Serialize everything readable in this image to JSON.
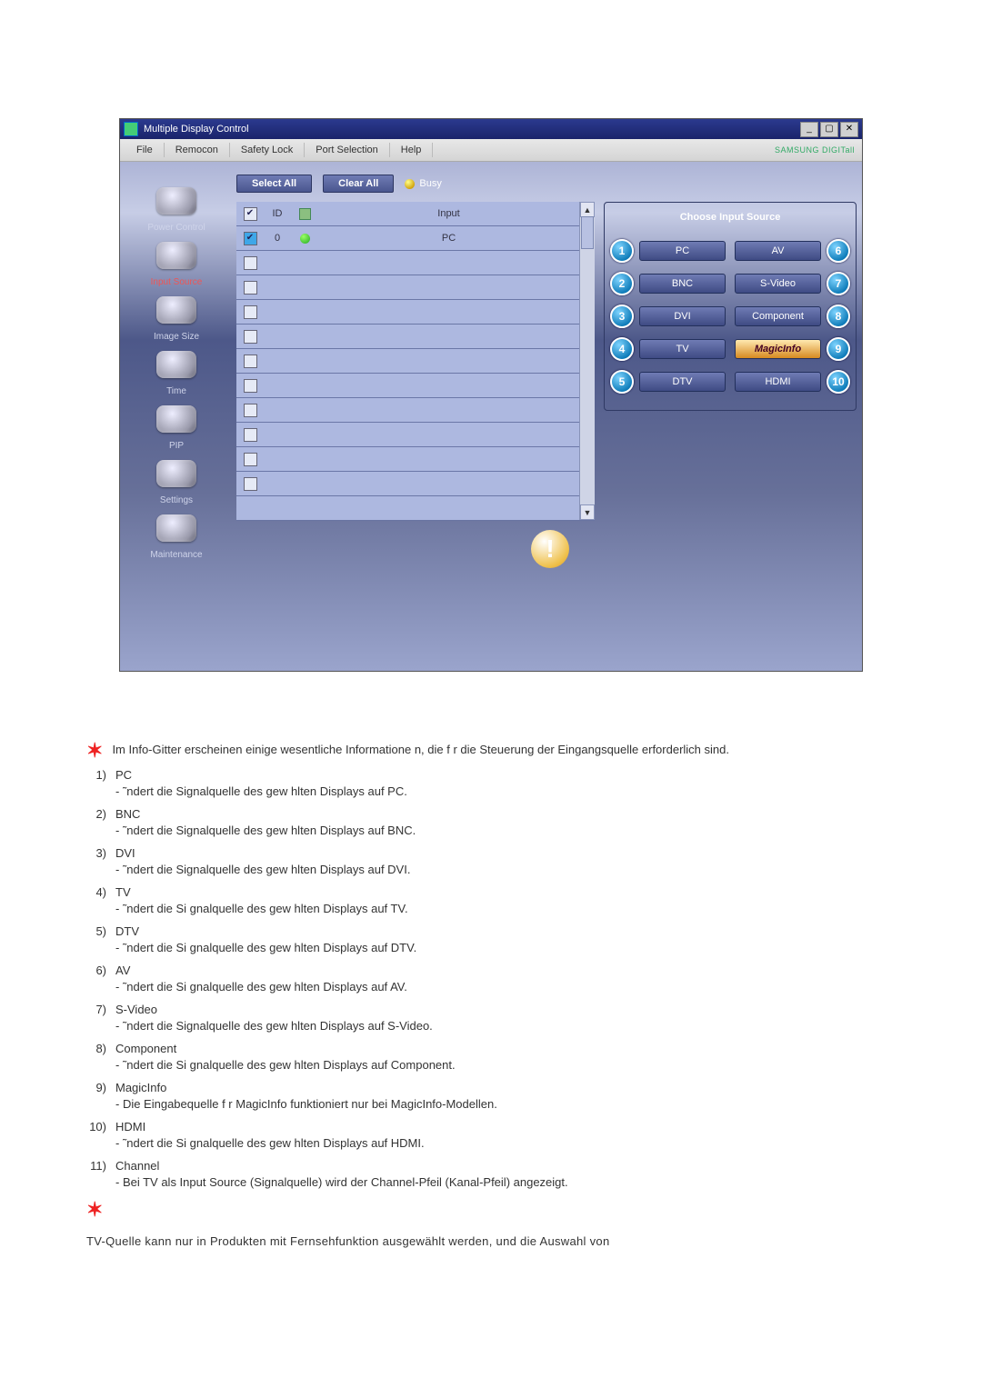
{
  "window": {
    "title": "Multiple Display Control",
    "brand": "SAMSUNG DIGITall"
  },
  "menu": [
    "File",
    "Remocon",
    "Safety Lock",
    "Port Selection",
    "Help"
  ],
  "sidebar": [
    {
      "label": "Power Control",
      "active": false
    },
    {
      "label": "Input Source",
      "active": true
    },
    {
      "label": "Image Size",
      "active": false
    },
    {
      "label": "Time",
      "active": false
    },
    {
      "label": "PIP",
      "active": false
    },
    {
      "label": "Settings",
      "active": false
    },
    {
      "label": "Maintenance",
      "active": false
    }
  ],
  "toolbar": {
    "select_all": "Select All",
    "clear_all": "Clear All",
    "busy": "Busy"
  },
  "grid": {
    "header": {
      "id": "ID",
      "input": "Input"
    },
    "rows": [
      {
        "checked": true,
        "selected": true,
        "id": "0",
        "status": "on",
        "input": "PC"
      },
      {
        "checked": false,
        "selected": false,
        "id": "",
        "status": "none",
        "input": ""
      },
      {
        "checked": false,
        "selected": false,
        "id": "",
        "status": "none",
        "input": ""
      },
      {
        "checked": false,
        "selected": false,
        "id": "",
        "status": "none",
        "input": ""
      },
      {
        "checked": false,
        "selected": false,
        "id": "",
        "status": "none",
        "input": ""
      },
      {
        "checked": false,
        "selected": false,
        "id": "",
        "status": "none",
        "input": ""
      },
      {
        "checked": false,
        "selected": false,
        "id": "",
        "status": "none",
        "input": ""
      },
      {
        "checked": false,
        "selected": false,
        "id": "",
        "status": "none",
        "input": ""
      },
      {
        "checked": false,
        "selected": false,
        "id": "",
        "status": "none",
        "input": ""
      },
      {
        "checked": false,
        "selected": false,
        "id": "",
        "status": "none",
        "input": ""
      },
      {
        "checked": false,
        "selected": false,
        "id": "",
        "status": "none",
        "input": ""
      }
    ]
  },
  "panel": {
    "title": "Choose Input Source",
    "left": [
      {
        "n": "1",
        "label": "PC"
      },
      {
        "n": "2",
        "label": "BNC"
      },
      {
        "n": "3",
        "label": "DVI"
      },
      {
        "n": "4",
        "label": "TV"
      },
      {
        "n": "5",
        "label": "DTV"
      }
    ],
    "right": [
      {
        "n": "6",
        "label": "AV"
      },
      {
        "n": "7",
        "label": "S-Video"
      },
      {
        "n": "8",
        "label": "Component"
      },
      {
        "n": "9",
        "label": "MagicInfo",
        "shiny": true
      },
      {
        "n": "10",
        "label": "HDMI"
      }
    ]
  },
  "doc": {
    "intro": "Im Info-Gitter erscheinen einige wesentliche Informatione n, die f r die Steuerung der Eingangsquelle erforderlich sind.",
    "items": [
      {
        "n": "1)",
        "h": "PC",
        "d": "- ˜ndert die Signalquelle des gew hlten Displays auf PC."
      },
      {
        "n": "2)",
        "h": "BNC",
        "d": "- ˜ndert die Signalquelle des gew hlten Displays auf BNC."
      },
      {
        "n": "3)",
        "h": "DVI",
        "d": "- ˜ndert die Signalquelle des gew hlten Displays auf DVI."
      },
      {
        "n": "4)",
        "h": "TV",
        "d": "- ˜ndert die Si gnalquelle des gew hlten Displays auf TV."
      },
      {
        "n": "5)",
        "h": "DTV",
        "d": "- ˜ndert die Si gnalquelle des gew hlten Displays auf DTV."
      },
      {
        "n": "6)",
        "h": "AV",
        "d": "- ˜ndert die Si gnalquelle des gew hlten Displays auf AV."
      },
      {
        "n": "7)",
        "h": "S-Video",
        "d": "- ˜ndert die Signalquelle des gew hlten Displays auf S-Video."
      },
      {
        "n": "8)",
        "h": "Component",
        "d": "- ˜ndert die Si gnalquelle des gew hlten Displays auf Component."
      },
      {
        "n": "9)",
        "h": "MagicInfo",
        "d": "- Die Eingabequelle f r MagicInfo funktioniert nur bei MagicInfo-Modellen."
      },
      {
        "n": "10)",
        "h": "HDMI",
        "d": "- ˜ndert die Si gnalquelle des gew hlten Displays auf HDMI."
      },
      {
        "n": "11)",
        "h": "Channel",
        "d": "- Bei TV als Input Source (Signalquelle) wird der Channel-Pfeil (Kanal-Pfeil) angezeigt."
      }
    ],
    "note": "TV-Quelle kann nur in Produkten mit Fernsehfunktion ausgewählt werden, und die Auswahl von"
  }
}
